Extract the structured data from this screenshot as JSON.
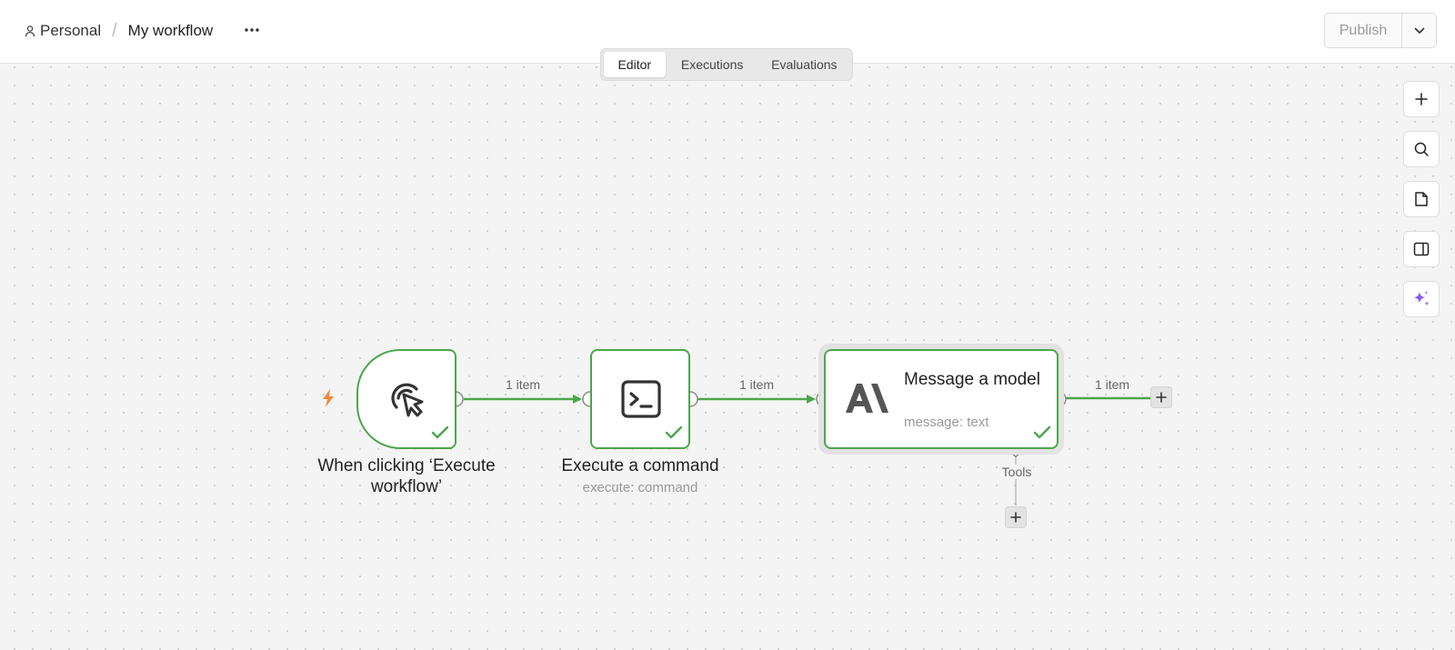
{
  "header": {
    "breadcrumb": {
      "project": "Personal",
      "separator": "/",
      "workflow_name": "My workflow"
    },
    "more_label": "···",
    "tabs": [
      {
        "label": "Editor",
        "active": true
      },
      {
        "label": "Executions",
        "active": false
      },
      {
        "label": "Evaluations",
        "active": false
      }
    ],
    "publish_label": "Publish"
  },
  "side_tools": [
    "zoom-in-icon",
    "search-icon",
    "sticky-note-icon",
    "panel-icon",
    "ai-sparkle-icon"
  ],
  "nodes": {
    "trigger": {
      "label": "When clicking ‘Execute workflow’",
      "icon": "cursor-click-icon",
      "status": "success"
    },
    "command": {
      "label": "Execute a command",
      "subtitle": "execute: command",
      "icon": "terminal-icon",
      "status": "success"
    },
    "model": {
      "label": "Message a model",
      "subtitle": "message: text",
      "icon": "anthropic-logo-icon",
      "status": "success"
    }
  },
  "edges": {
    "e1": "1 item",
    "e2": "1 item",
    "e3": "1 item"
  },
  "tools_label": "Tools",
  "colors": {
    "success": "#4ca64c",
    "trigger_bolt": "#f08a3c",
    "ai_sparkle": "#8a5cf6"
  }
}
